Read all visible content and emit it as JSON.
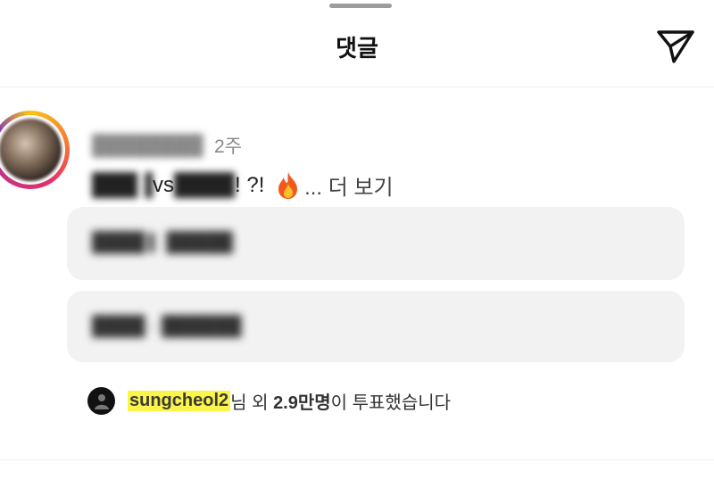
{
  "header": {
    "title": "댓글",
    "send_icon": "paper-plane-icon"
  },
  "comment": {
    "time": "2주",
    "text_mid": "vs",
    "text_end": "! ?!",
    "emoji": "🔥",
    "more": "... 더 보기"
  },
  "poll": {
    "voter_name": "sungcheol2",
    "summary_pre": "님 외 ",
    "count": "2.9만명",
    "summary_post": "이 투표했습니다"
  },
  "colors": {
    "highlight": "#fbf54a",
    "option_bg": "#f2f2f3",
    "ring_gradient": [
      "#f9c513",
      "#f77737",
      "#e1306c",
      "#c13584",
      "#833ab4"
    ]
  }
}
